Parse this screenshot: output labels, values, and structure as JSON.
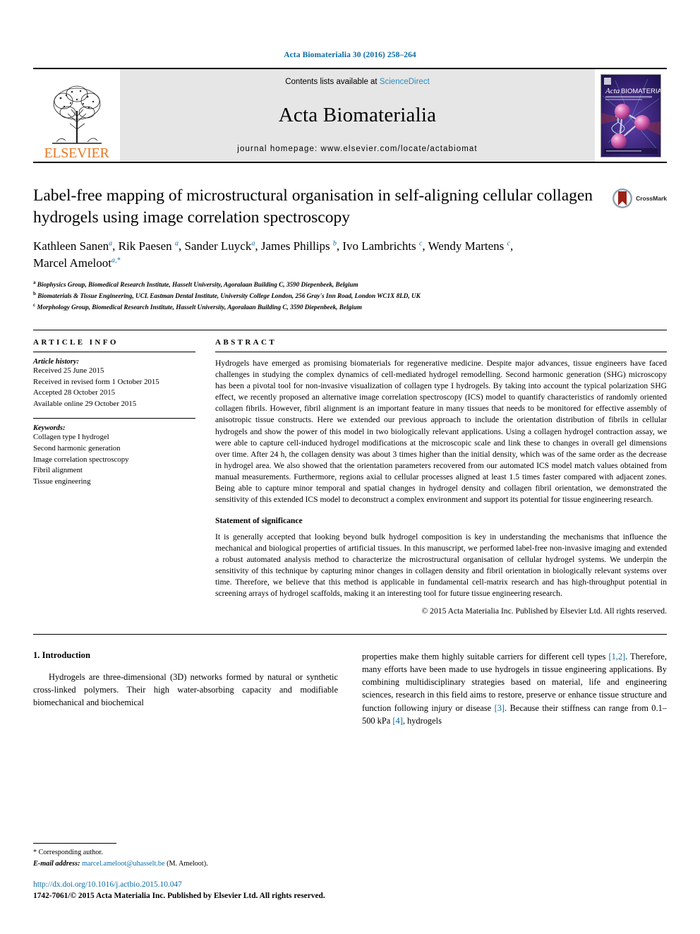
{
  "running_head": "Acta Biomaterialia 30 (2016) 258–264",
  "masthead": {
    "publisher_name": "ELSEVIER",
    "contents_prefix": "Contents lists available at",
    "sciencedirect": "ScienceDirect",
    "journal_title": "Acta Biomaterialia",
    "homepage": "journal homepage: www.elsevier.com/locate/actabiomat",
    "cover_title": "Acta BIOMATERIALIA"
  },
  "article": {
    "title": "Label-free mapping of microstructural organisation in self-aligning cellular collagen hydrogels using image correlation spectroscopy",
    "crossmark_label": "CrossMark",
    "authors_line1": "Kathleen Sanen a, Rik Paesen a, Sander Luyck a, James Phillips b, Ivo Lambrichts c, Wendy Martens c,",
    "authors_line2": "Marcel Ameloot a,*",
    "authors": [
      {
        "name": "Kathleen Sanen",
        "marker": "a",
        "sep": ", "
      },
      {
        "name": "Rik Paesen",
        "marker": "a",
        "sep": ", "
      },
      {
        "name": "Sander Luyck",
        "marker": "a",
        "sep": ", "
      },
      {
        "name": "James Phillips",
        "marker": "b",
        "sep": ", "
      },
      {
        "name": "Ivo Lambrichts",
        "marker": "c",
        "sep": ", "
      },
      {
        "name": "Wendy Martens",
        "marker": "c",
        "sep": ","
      },
      {
        "name": "Marcel Ameloot",
        "marker": "a,*",
        "sep": ""
      }
    ],
    "affiliations": [
      {
        "marker": "a",
        "text": "Biophysics Group, Biomedical Research Institute, Hasselt University, Agoralaan Building C, 3590 Diepenbeek, Belgium"
      },
      {
        "marker": "b",
        "text": "Biomaterials & Tissue Engineering, UCL Eastman Dental Institute, University College London, 256 Gray's Inn Road, London WC1X 8LD, UK"
      },
      {
        "marker": "c",
        "text": "Morphology Group, Biomedical Research Institute, Hasselt University, Agoralaan Building C, 3590 Diepenbeek, Belgium"
      }
    ]
  },
  "article_info": {
    "heading": "ARTICLE INFO",
    "history_title": "Article history:",
    "history": [
      "Received 25 June 2015",
      "Received in revised form 1 October 2015",
      "Accepted 28 October 2015",
      "Available online 29 October 2015"
    ],
    "keywords_title": "Keywords:",
    "keywords": [
      "Collagen type I hydrogel",
      "Second harmonic generation",
      "Image correlation spectroscopy",
      "Fibril alignment",
      "Tissue engineering"
    ]
  },
  "abstract": {
    "heading": "ABSTRACT",
    "text": "Hydrogels have emerged as promising biomaterials for regenerative medicine. Despite major advances, tissue engineers have faced challenges in studying the complex dynamics of cell-mediated hydrogel remodelling. Second harmonic generation (SHG) microscopy has been a pivotal tool for non-invasive visualization of collagen type I hydrogels. By taking into account the typical polarization SHG effect, we recently proposed an alternative image correlation spectroscopy (ICS) model to quantify characteristics of randomly oriented collagen fibrils. However, fibril alignment is an important feature in many tissues that needs to be monitored for effective assembly of anisotropic tissue constructs. Here we extended our previous approach to include the orientation distribution of fibrils in cellular hydrogels and show the power of this model in two biologically relevant applications. Using a collagen hydrogel contraction assay, we were able to capture cell-induced hydrogel modifications at the microscopic scale and link these to changes in overall gel dimensions over time. After 24 h, the collagen density was about 3 times higher than the initial density, which was of the same order as the decrease in hydrogel area. We also showed that the orientation parameters recovered from our automated ICS model match values obtained from manual measurements. Furthermore, regions axial to cellular processes aligned at least 1.5 times faster compared with adjacent zones. Being able to capture minor temporal and spatial changes in hydrogel density and collagen fibril orientation, we demonstrated the sensitivity of this extended ICS model to deconstruct a complex environment and support its potential for tissue engineering research.",
    "statement_heading": "Statement of significance",
    "statement_text": "It is generally accepted that looking beyond bulk hydrogel composition is key in understanding the mechanisms that influence the mechanical and biological properties of artificial tissues. In this manuscript, we performed label-free non-invasive imaging and extended a robust automated analysis method to characterize the microstructural organisation of cellular hydrogel systems. We underpin the sensitivity of this technique by capturing minor changes in collagen density and fibril orientation in biologically relevant systems over time. Therefore, we believe that this method is applicable in fundamental cell-matrix research and has high-throughput potential in screening arrays of hydrogel scaffolds, making it an interesting tool for future tissue engineering research.",
    "copyright": "© 2015 Acta Materialia Inc. Published by Elsevier Ltd. All rights reserved."
  },
  "introduction": {
    "heading": "1. Introduction",
    "left_paragraph": "Hydrogels are three-dimensional (3D) networks formed by natural or synthetic cross-linked polymers. Their high water-absorbing capacity and modifiable biomechanical and biochemical",
    "right_part1": "properties make them highly suitable carriers for different cell types ",
    "right_ref1": "[1,2]",
    "right_part2": ". Therefore, many efforts have been made to use hydrogels in tissue engineering applications. By combining multidisciplinary strategies based on material, life and engineering sciences, research in this field aims to restore, preserve or enhance tissue structure and function following injury or disease ",
    "right_ref2": "[3]",
    "right_part3": ". Because their stiffness can range from 0.1–500 kPa ",
    "right_ref3": "[4]",
    "right_part4": ", hydrogels"
  },
  "footnotes": {
    "corresponding": "Corresponding author.",
    "email_label": "E-mail address:",
    "email": "marcel.ameloot@uhasselt.be",
    "email_suffix": "(M. Ameloot).",
    "doi": "http://dx.doi.org/10.1016/j.actbio.2015.10.047",
    "issn": "1742-7061/© 2015 Acta Materialia Inc. Published by Elsevier Ltd. All rights reserved."
  },
  "colors": {
    "link_blue": "#0b6ba5",
    "elsevier_orange": "#e87722",
    "band_gray": "#e6e6e6",
    "crossmark_red": "#9c2118"
  }
}
